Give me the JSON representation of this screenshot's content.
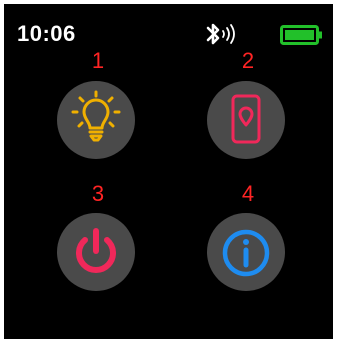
{
  "status_bar": {
    "time": "10:06",
    "bluetooth_icon": "bluetooth-vibrate-icon",
    "battery_icon": "battery-full-icon",
    "battery_color": "#22c02a"
  },
  "menu": {
    "items": [
      {
        "number": "1",
        "icon": "lightbulb-icon",
        "color": "#f0b000"
      },
      {
        "number": "2",
        "icon": "phone-location-icon",
        "color": "#f0285a"
      },
      {
        "number": "3",
        "icon": "power-icon",
        "color": "#f0285a"
      },
      {
        "number": "4",
        "icon": "info-icon",
        "color": "#1e8cf0"
      }
    ]
  },
  "colors": {
    "background": "#000000",
    "tile": "#4a4a4a",
    "number_label": "#ff2424"
  }
}
